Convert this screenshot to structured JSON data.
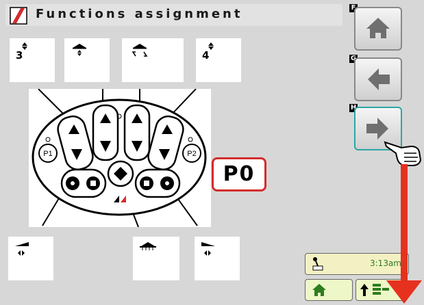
{
  "header": {
    "title": "Functions assignment"
  },
  "top_slots": [
    {
      "number": "3"
    },
    {
      "number": ""
    },
    {
      "number": ""
    },
    {
      "number": "4"
    }
  ],
  "program_label": "P0",
  "joystick": {
    "p1_label": "P1",
    "p2_label": "P2"
  },
  "side_buttons": [
    {
      "letter": "F",
      "icon": "home-icon"
    },
    {
      "letter": "G",
      "icon": "arrow-left-icon"
    },
    {
      "letter": "H",
      "icon": "arrow-right-icon"
    }
  ],
  "status": {
    "time": "3:13am"
  },
  "colors": {
    "accent_red": "#d52b2b",
    "active_teal": "#2aa6a6",
    "status_bg": "#f3f1c4"
  }
}
